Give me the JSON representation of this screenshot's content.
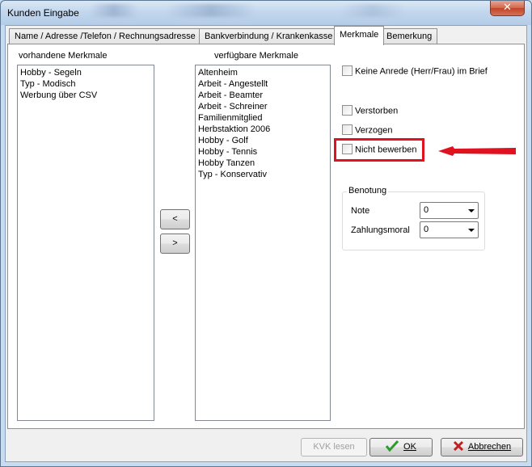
{
  "window": {
    "title": "Kunden Eingabe",
    "close_glyph": "✕"
  },
  "tabs": [
    {
      "label": "Name / Adresse /Telefon / Rechnungsadresse",
      "active": false
    },
    {
      "label": "Bankverbindung / Krankenkasse",
      "active": false
    },
    {
      "label": "Merkmale",
      "active": true
    },
    {
      "label": "Bemerkung",
      "active": false
    }
  ],
  "merkmale": {
    "vorhandene_label": "vorhandene Merkmale",
    "vorhandene_items": [
      "Hobby - Segeln",
      "Typ - Modisch",
      "Werbung über CSV"
    ],
    "verfuegbare_label": "verfügbare Merkmale",
    "verfuegbare_items": [
      "Altenheim",
      "Arbeit - Angestellt",
      "Arbeit - Beamter",
      "Arbeit - Schreiner",
      "Familienmitglied",
      "Herbstaktion 2006",
      "Hobby - Golf",
      "Hobby - Tennis",
      "Hobby Tanzen",
      "Typ - Konservativ"
    ],
    "move_left_label": "<",
    "move_right_label": ">"
  },
  "options": {
    "keine_anrede": {
      "label": "Keine Anrede (Herr/Frau) im Brief",
      "checked": false
    },
    "verstorben": {
      "label": "Verstorben",
      "checked": false
    },
    "verzogen": {
      "label": "Verzogen",
      "checked": false
    },
    "nicht_bewerben": {
      "label": "Nicht bewerben",
      "checked": false
    }
  },
  "benotung": {
    "title": "Benotung",
    "note_label": "Note",
    "note_value": "0",
    "zahlungsmoral_label": "Zahlungsmoral",
    "zahlungsmoral_value": "0"
  },
  "footer": {
    "kvk_label": "KVK lesen",
    "ok_label": "OK",
    "abbrechen_label": "Abbrechen"
  },
  "colors": {
    "highlight": "#e0121f",
    "ok_check": "#2f9a2f",
    "cancel_x": "#c02020"
  },
  "icons": [
    "close-icon",
    "checkmark-icon",
    "cancel-x-icon",
    "dropdown-arrow-icon",
    "annotation-arrow-icon"
  ]
}
